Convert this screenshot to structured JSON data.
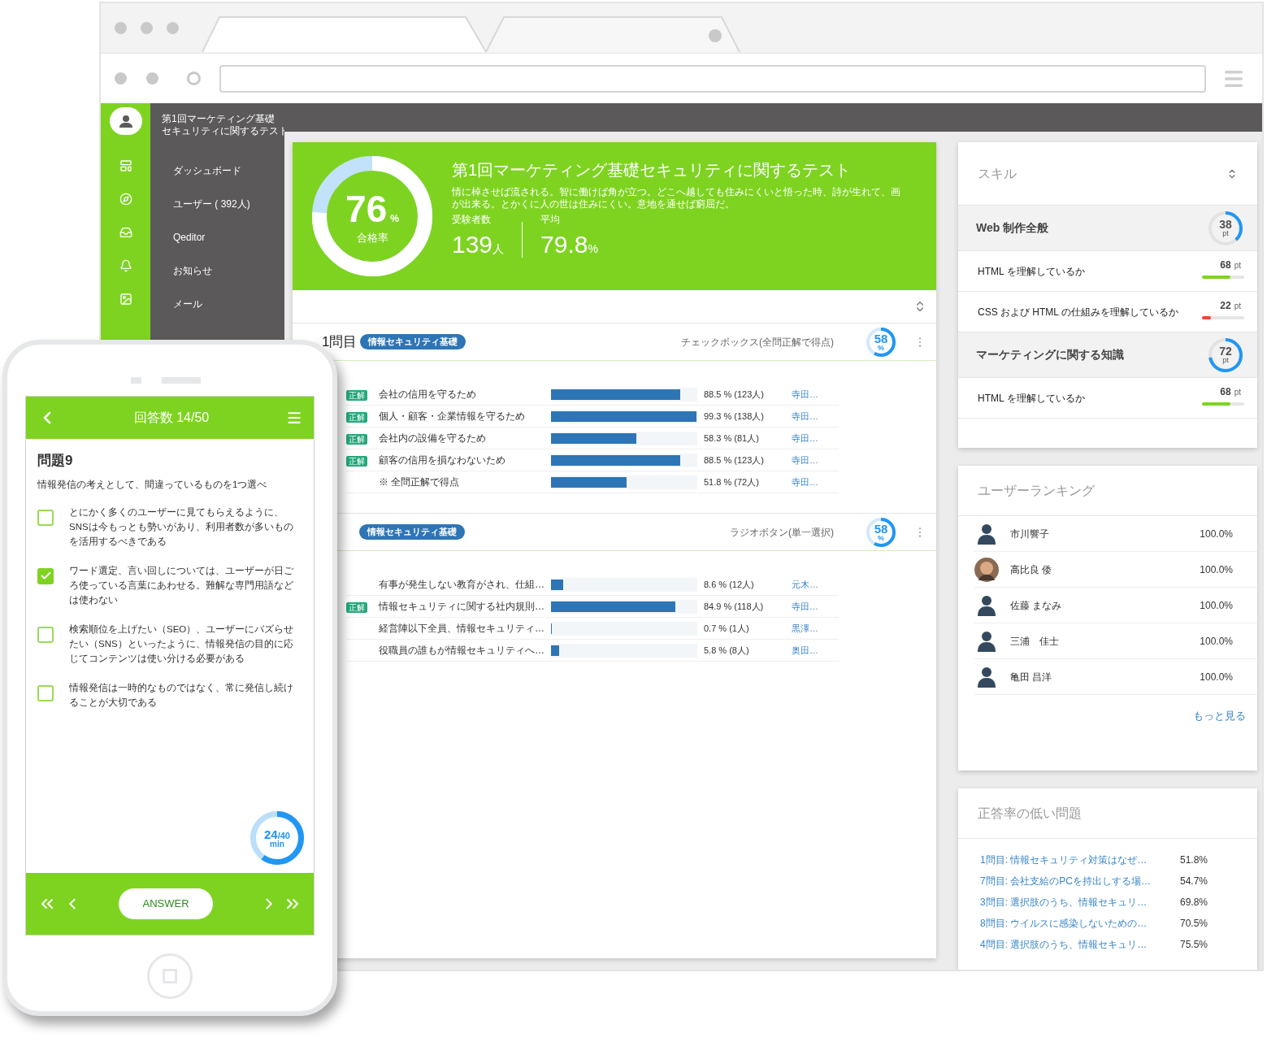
{
  "sidebar": {
    "title_lines": [
      "第1回マーケティング基礎",
      "セキュリティに関するテスト"
    ],
    "items": [
      {
        "kind": "dashboard",
        "label": "ダッシュボード"
      },
      {
        "kind": "users",
        "label": "ユーザー ( 392人)"
      },
      {
        "kind": "editor",
        "label": "Qeditor"
      },
      {
        "kind": "notice",
        "label": "お知らせ"
      },
      {
        "kind": "mail",
        "label": "メール"
      }
    ]
  },
  "summary": {
    "rate": "76",
    "rate_unit": "%",
    "rate_label": "合格率",
    "level": 0.76,
    "title": "第1回マーケティング基礎セキュリティに関するテスト",
    "description": "情に棹させば流される。智に働けば角が立つ。どこへ越しても住みにくいと悟った時、詩が生れて、画が出来る。とかくに人の世は住みにくい。意地を通せば窮屈だ。",
    "stats": [
      {
        "label": "受験者数",
        "value": "139",
        "unit": "人"
      },
      {
        "label": "平均",
        "value": "79.8",
        "unit": "%"
      }
    ]
  },
  "questions": [
    {
      "title": "1問目",
      "tag": "情報セキュリティ基礎",
      "type": "チェックボックス(全問正解で得点)",
      "score": "58",
      "score_unit": "%",
      "level": 0.58,
      "rows": [
        {
          "correct": true,
          "badge": "正解",
          "label": "会社の信用を守るため",
          "level": 0.885,
          "reading": "88.5 % (123人)",
          "users": "寺田…"
        },
        {
          "correct": true,
          "badge": "正解",
          "label": "個人・顧客・企業情報を守るため",
          "level": 0.993,
          "reading": "99.3 % (138人)",
          "users": "寺田…"
        },
        {
          "correct": true,
          "badge": "正解",
          "label": "会社内の設備を守るため",
          "level": 0.583,
          "reading": "58.3 % (81人)",
          "users": "寺田…"
        },
        {
          "correct": true,
          "badge": "正解",
          "label": "顧客の信用を損なわないため",
          "level": 0.885,
          "reading": "88.5 % (123人)",
          "users": "寺田…"
        },
        {
          "correct": false,
          "label": "※ 全問正解で得点",
          "level": 0.518,
          "reading": "51.8 % (72人)",
          "users": "寺田…"
        }
      ]
    },
    {
      "tag": "情報セキュリティ基礎",
      "type": "ラジオボタン(単一選択)",
      "score": "58",
      "score_unit": "%",
      "level": 0.58,
      "rows": [
        {
          "correct": false,
          "label": "有事が発生しない教育がされ、仕組…",
          "level": 0.086,
          "reading": "8.6 % (12人)",
          "users": "元木…"
        },
        {
          "correct": true,
          "badge": "正解",
          "label": "情報セキュリティに関する社内規則…",
          "level": 0.849,
          "reading": "84.9 % (118人)",
          "users": "寺田…"
        },
        {
          "correct": false,
          "label": "経営陣以下全員、情報セキュリティ…",
          "level": 0.007,
          "reading": "0.7 % (1人)",
          "users": "黒澤…"
        },
        {
          "correct": false,
          "label": "役職員の誰もが情報セキュリティへ…",
          "level": 0.058,
          "reading": "5.8 % (8人)",
          "users": "奥田…"
        }
      ]
    }
  ],
  "skills": {
    "title": "スキル",
    "groups": [
      {
        "name": "Web 制作全般",
        "score": "38",
        "unit": "pt",
        "level": 0.38,
        "items": [
          {
            "label": "HTML を理解しているか",
            "score": "68",
            "unit": "pt",
            "level": 0.68,
            "color": "#7ed321"
          },
          {
            "label": "CSS および HTML の仕組みを理解しているか",
            "score": "22",
            "unit": "pt",
            "level": 0.22,
            "color": "#f44336"
          }
        ]
      },
      {
        "name": "マーケティングに関する知識",
        "score": "72",
        "unit": "pt",
        "level": 0.72,
        "items": [
          {
            "label": "HTML を理解しているか",
            "score": "68",
            "unit": "pt",
            "level": 0.68,
            "color": "#7ed321"
          }
        ]
      }
    ]
  },
  "ranking": {
    "title": "ユーザーランキング",
    "users": [
      {
        "kind": "default",
        "name": "市川響子",
        "rate": "100.0%"
      },
      {
        "kind": "photo",
        "name": "高比良 倭",
        "rate": "100.0%"
      },
      {
        "kind": "default",
        "name": "佐藤 まなみ",
        "rate": "100.0%"
      },
      {
        "kind": "default",
        "name": "三浦　佳士",
        "rate": "100.0%"
      },
      {
        "kind": "default",
        "name": "亀田 昌洋",
        "rate": "100.0%"
      }
    ],
    "more": "もっと見る"
  },
  "low_rate": {
    "title": "正答率の低い問題",
    "items": [
      {
        "label": "1問目: 情報セキュリティ対策はなぜ…",
        "rate": "51.8%"
      },
      {
        "label": "7問目: 会社支給のPCを持出しする場…",
        "rate": "54.7%"
      },
      {
        "label": "3問目: 選択肢のうち、情報セキュリ…",
        "rate": "69.8%"
      },
      {
        "label": "8問目: ウイルスに感染しないための…",
        "rate": "70.5%"
      },
      {
        "label": "4問目: 選択肢のうち、情報セキュリ…",
        "rate": "75.5%"
      }
    ]
  },
  "phone": {
    "header": "回答数 14/50",
    "question_title": "問題9",
    "prompt": "情報発信の考えとして、間違っているものを1つ選べ",
    "options": [
      {
        "text": "とにかく多くのユーザーに見てもらえるように、SNSは今もっとも勢いがあり、利用者数が多いものを活用するべきである",
        "checked": false
      },
      {
        "text": "ワード選定、言い回しについては、ユーザーが日ごろ使っている言葉にあわせる。難解な専門用語などは使わない",
        "checked": true
      },
      {
        "text": "検索順位を上げたい（SEO）、ユーザーにバズらせたい（SNS）といったように、情報発信の目的に応じてコンテンツは使い分ける必要がある",
        "checked": false
      },
      {
        "text": "情報発信は一時的なものではなく、常に発信し続けることが大切である",
        "checked": false
      }
    ],
    "timer": {
      "value": "24",
      "total": "/40",
      "unit": "min",
      "level": 0.6
    },
    "answer_button": "ANSWER"
  }
}
